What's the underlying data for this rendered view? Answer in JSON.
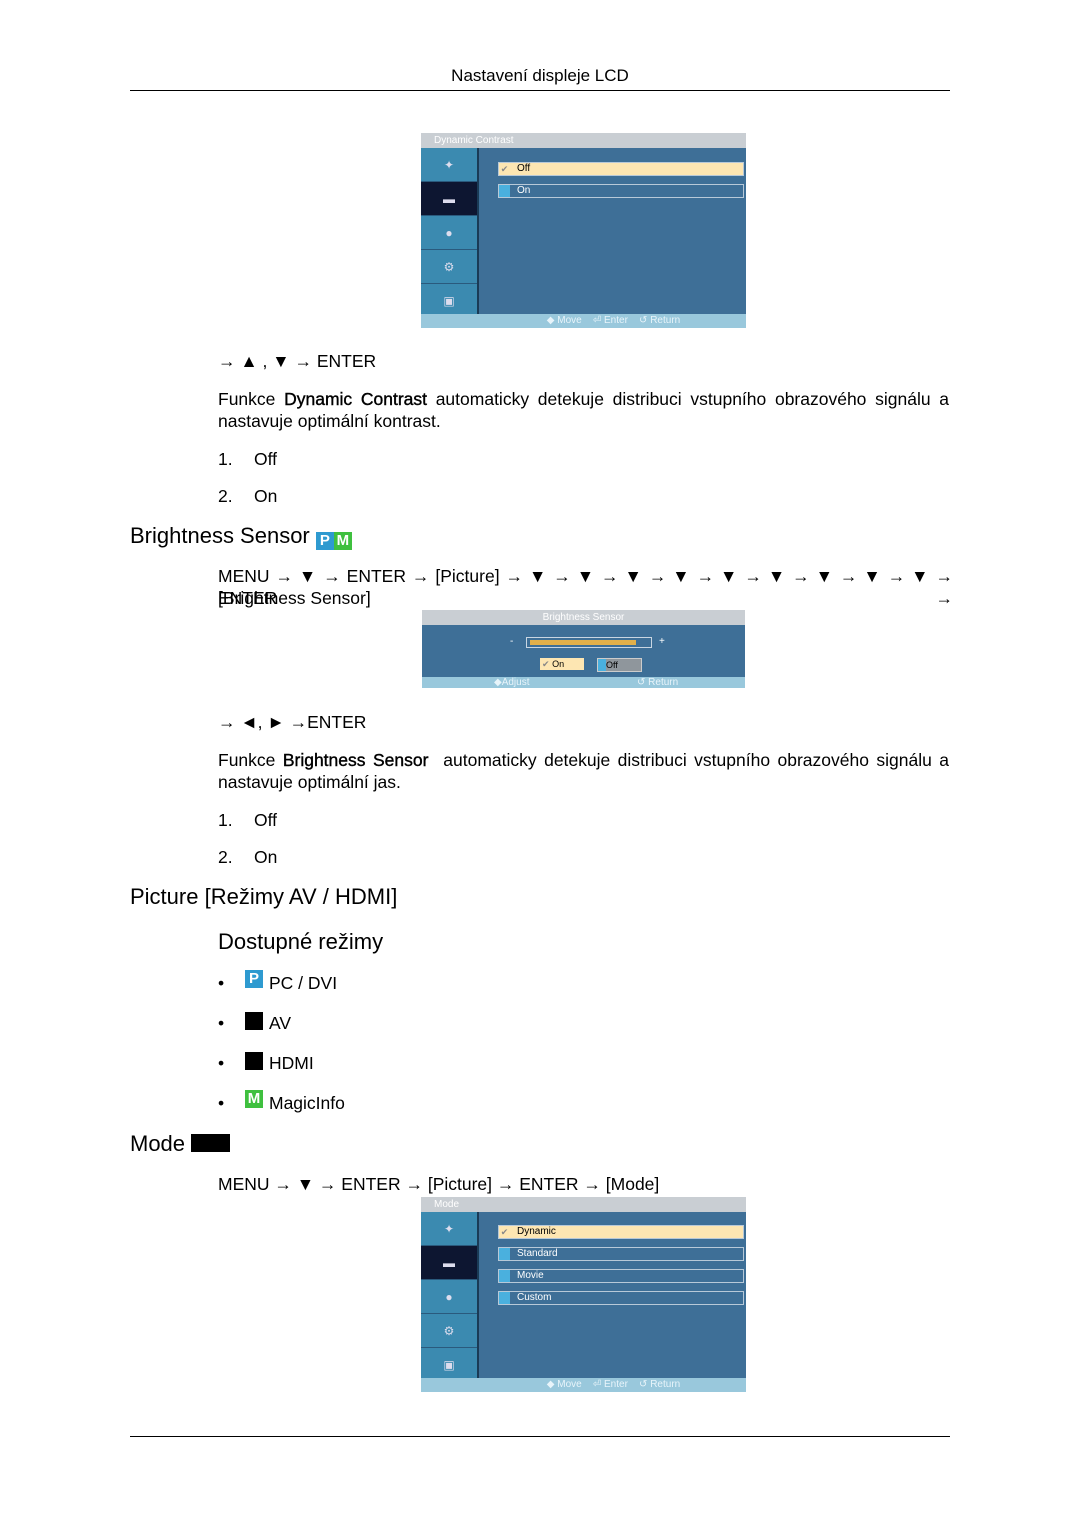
{
  "header": {
    "title": "Nastavení displeje LCD"
  },
  "osd1": {
    "title": "Dynamic Contrast",
    "options": [
      "Off",
      "On"
    ],
    "selected": "Off",
    "footer": {
      "move": "Move",
      "enter": "Enter",
      "return": "Return"
    }
  },
  "sec1": {
    "nav": "→ ▲ , ▼ → ENTER",
    "desc_pre": "Funkce ",
    "desc_bold": "Dynamic Contrast",
    "desc_post": " automaticky detekuje distribuci vstupního obrazového signálu a nastavuje optimální kontrast.",
    "items": [
      {
        "n": "1.",
        "label": "Off"
      },
      {
        "n": "2.",
        "label": "On"
      }
    ]
  },
  "sec2": {
    "title": "Brightness Sensor",
    "badges": [
      "P",
      "M"
    ],
    "path": "MENU → ▼ → ENTER → [Picture] → ▼ → ▼ → ▼ → ▼ → ▼ → ▼ → ▼ → ▼ → ▼ → ENTER →",
    "path2": "[Brightness Sensor]",
    "osd": {
      "title": "Brightness Sensor",
      "minus": "-",
      "plus": "+",
      "level": 0.9,
      "on": "On",
      "off": "Off",
      "selected": "On",
      "adjust": "Adjust",
      "return": "Return"
    },
    "nav": "→ ◄, ► →ENTER",
    "desc_pre": "Funkce ",
    "desc_bold": "Brightness Sensor",
    "desc_post": "  automaticky detekuje distribuci vstupního obrazového signálu a nastavuje optimální jas.",
    "items": [
      {
        "n": "1.",
        "label": "Off"
      },
      {
        "n": "2.",
        "label": "On"
      }
    ]
  },
  "sec3": {
    "title": "Picture [Režimy AV / HDMI]",
    "subtitle": "Dostupné režimy",
    "modes": [
      {
        "badge": "P",
        "label": "PC / DVI"
      },
      {
        "badge": "",
        "label": "AV"
      },
      {
        "badge": "",
        "label": "HDMI"
      },
      {
        "badge": "M",
        "label": "MagicInfo"
      }
    ],
    "bullet": "•"
  },
  "sec4": {
    "title": "Mode",
    "path": "MENU → ▼ → ENTER → [Picture] → ENTER → [Mode]",
    "osd": {
      "title": "Mode",
      "options": [
        "Dynamic",
        "Standard",
        "Movie",
        "Custom"
      ],
      "selected": "Dynamic",
      "footer": {
        "move": "Move",
        "enter": "Enter",
        "return": "Return"
      }
    }
  },
  "colors": {
    "badge_p": "#2e9ad0",
    "badge_m": "#3fc03f",
    "osd_bg": "#3e6f97",
    "osd_selected": "#fde6b2"
  }
}
